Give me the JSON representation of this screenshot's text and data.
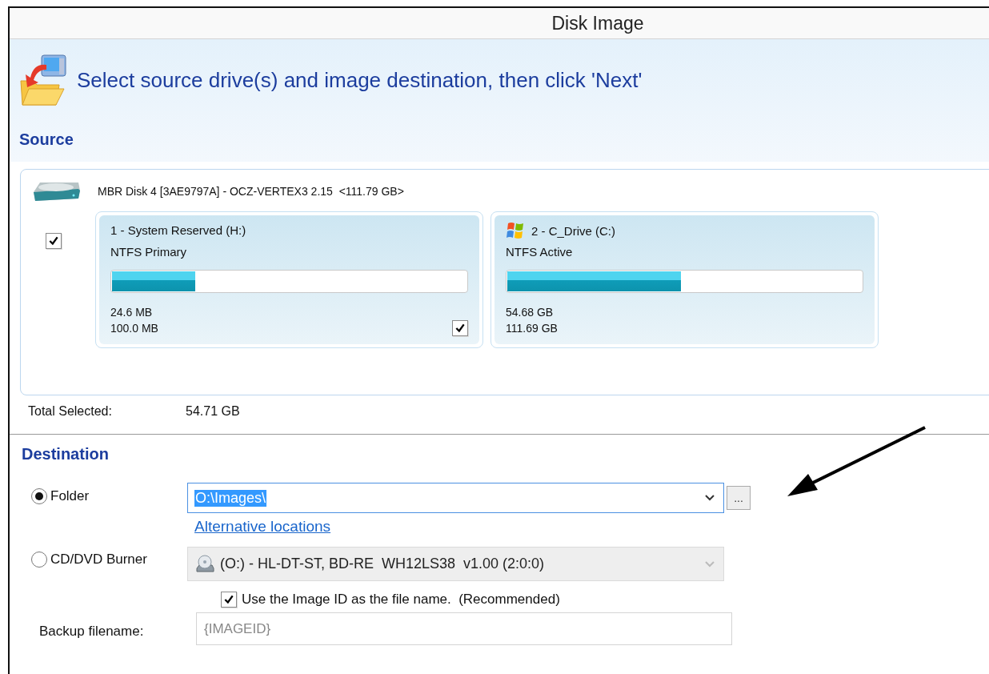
{
  "window": {
    "title": "Disk Image"
  },
  "header": {
    "instruction": "Select source drive(s) and image destination, then click 'Next'"
  },
  "source": {
    "heading": "Source",
    "disk": {
      "label": "MBR Disk 4 [3AE9797A] - OCZ-VERTEX3 2.15  <111.79 GB>",
      "checked": true,
      "partitions": [
        {
          "kind": "plain",
          "title": "1 - System Reserved (H:)",
          "type": "NTFS Primary",
          "level": 0.235,
          "used": "24.6 MB",
          "total": "100.0 MB",
          "checked": true
        },
        {
          "kind": "windows",
          "title": "2 - C_Drive (C:)",
          "type": "NTFS Active",
          "level": 0.49,
          "used": "54.68 GB",
          "total": "111.69 GB"
        }
      ]
    }
  },
  "total_selected": {
    "label": "Total Selected:",
    "value": "54.71 GB"
  },
  "destination": {
    "heading": "Destination",
    "options": [
      {
        "kind": "folder",
        "label": "Folder",
        "selected": true,
        "value": "O:\\Images\\",
        "highlighted": true,
        "disabled": false,
        "link": "Alternative locations",
        "browse": "..."
      },
      {
        "kind": "burner",
        "label": "CD/DVD Burner",
        "selected": false,
        "value": "(O:) - HL-DT-ST, BD-RE  WH12LS38  v1.00 (2:0:0)",
        "disabled": true
      }
    ],
    "use_image_id": {
      "label": "Use the Image ID as the file name.  (Recommended)",
      "checked": true
    },
    "backup_filename": {
      "label": "Backup filename:",
      "placeholder": "{IMAGEID}"
    }
  }
}
